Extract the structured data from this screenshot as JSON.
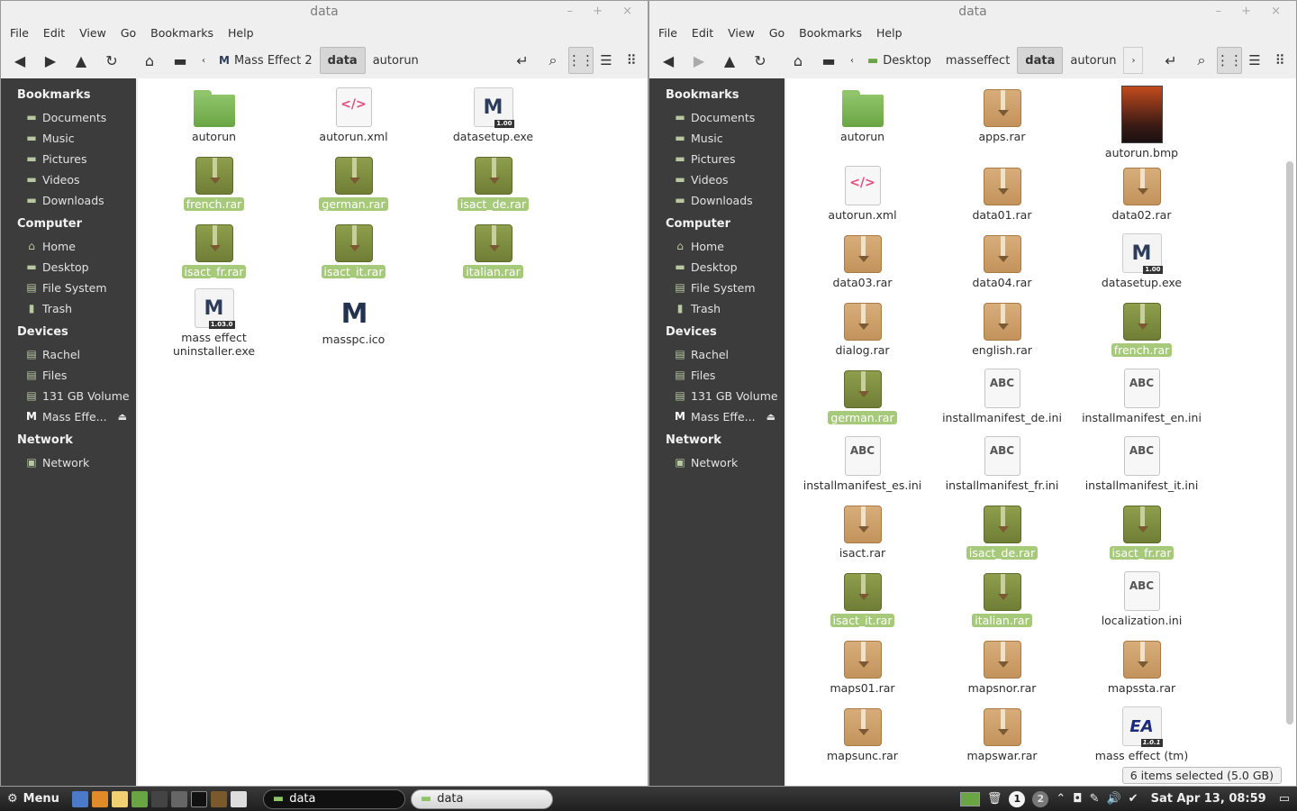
{
  "menus": [
    "File",
    "Edit",
    "View",
    "Go",
    "Bookmarks",
    "Help"
  ],
  "left": {
    "title": "data",
    "crumbs": [
      "Mass Effect 2",
      "data",
      "autorun"
    ],
    "active_crumb": "data",
    "sidebar": {
      "bookmarks_label": "Bookmarks",
      "bookmarks": [
        "Documents",
        "Music",
        "Pictures",
        "Videos",
        "Downloads"
      ],
      "computer_label": "Computer",
      "computer": [
        "Home",
        "Desktop",
        "File System",
        "Trash"
      ],
      "devices_label": "Devices",
      "devices": [
        "Rachel",
        "Files",
        "131 GB Volume",
        "Mass Effe..."
      ],
      "network_label": "Network",
      "network": [
        "Network"
      ]
    },
    "files": [
      {
        "name": "autorun",
        "kind": "folder",
        "selected": false
      },
      {
        "name": "autorun.xml",
        "kind": "xml",
        "selected": false
      },
      {
        "name": "datasetup.exe",
        "kind": "exe",
        "badge": "1.00",
        "selected": false
      },
      {
        "name": "french.rar",
        "kind": "rar",
        "selected": true
      },
      {
        "name": "german.rar",
        "kind": "rar",
        "selected": true
      },
      {
        "name": "isact_de.rar",
        "kind": "rar",
        "selected": true
      },
      {
        "name": "isact_fr.rar",
        "kind": "rar",
        "selected": true
      },
      {
        "name": "isact_it.rar",
        "kind": "rar",
        "selected": true
      },
      {
        "name": "italian.rar",
        "kind": "rar",
        "selected": true
      },
      {
        "name": "mass effect uninstaller.exe",
        "kind": "exe",
        "badge": "1.03.0",
        "selected": false
      },
      {
        "name": "masspc.ico",
        "kind": "ico",
        "selected": false
      }
    ]
  },
  "right": {
    "title": "data",
    "crumbs": [
      "Desktop",
      "masseffect",
      "data",
      "autorun"
    ],
    "active_crumb": "data",
    "status": "6 items selected (5.0 GB)",
    "files": [
      {
        "name": "autorun",
        "kind": "folder",
        "selected": false
      },
      {
        "name": "apps.rar",
        "kind": "rar",
        "selected": false
      },
      {
        "name": "autorun.bmp",
        "kind": "bmp",
        "selected": false
      },
      {
        "name": "autorun.xml",
        "kind": "xml",
        "selected": false
      },
      {
        "name": "data01.rar",
        "kind": "rar",
        "selected": false
      },
      {
        "name": "data02.rar",
        "kind": "rar",
        "selected": false
      },
      {
        "name": "data03.rar",
        "kind": "rar",
        "selected": false
      },
      {
        "name": "data04.rar",
        "kind": "rar",
        "selected": false
      },
      {
        "name": "datasetup.exe",
        "kind": "exe",
        "badge": "1.00",
        "selected": false
      },
      {
        "name": "dialog.rar",
        "kind": "rar",
        "selected": false
      },
      {
        "name": "english.rar",
        "kind": "rar",
        "selected": false
      },
      {
        "name": "french.rar",
        "kind": "rar",
        "selected": true
      },
      {
        "name": "german.rar",
        "kind": "rar",
        "selected": true
      },
      {
        "name": "installmanifest_de.ini",
        "kind": "ini",
        "selected": false
      },
      {
        "name": "installmanifest_en.ini",
        "kind": "ini",
        "selected": false
      },
      {
        "name": "installmanifest_es.ini",
        "kind": "ini",
        "selected": false
      },
      {
        "name": "installmanifest_fr.ini",
        "kind": "ini",
        "selected": false
      },
      {
        "name": "installmanifest_it.ini",
        "kind": "ini",
        "selected": false
      },
      {
        "name": "isact.rar",
        "kind": "rar",
        "selected": false
      },
      {
        "name": "isact_de.rar",
        "kind": "rar",
        "selected": true
      },
      {
        "name": "isact_fr.rar",
        "kind": "rar",
        "selected": true
      },
      {
        "name": "isact_it.rar",
        "kind": "rar",
        "selected": true
      },
      {
        "name": "italian.rar",
        "kind": "rar",
        "selected": true
      },
      {
        "name": "localization.ini",
        "kind": "ini",
        "selected": false
      },
      {
        "name": "maps01.rar",
        "kind": "rar",
        "selected": false
      },
      {
        "name": "mapsnor.rar",
        "kind": "rar",
        "selected": false
      },
      {
        "name": "mapssta.rar",
        "kind": "rar",
        "selected": false
      },
      {
        "name": "mapsunc.rar",
        "kind": "rar",
        "selected": false
      },
      {
        "name": "mapswar.rar",
        "kind": "rar",
        "selected": false
      },
      {
        "name": "mass effect (tm)",
        "kind": "ea",
        "badge": "1.0.1",
        "selected": false
      }
    ]
  },
  "icon_text": {
    "ini": "ABC",
    "xml": "</>",
    "exe": "M",
    "ea": "EA"
  },
  "panel": {
    "menu_label": "Menu",
    "tasks": [
      "data",
      "data"
    ],
    "workspaces": [
      "1",
      "2"
    ],
    "clock": "Sat Apr 13, 08:59"
  },
  "colors": {
    "selection": "#a6c97a",
    "sidebar": "#3c3c3c",
    "accent": "#8fc46a"
  }
}
